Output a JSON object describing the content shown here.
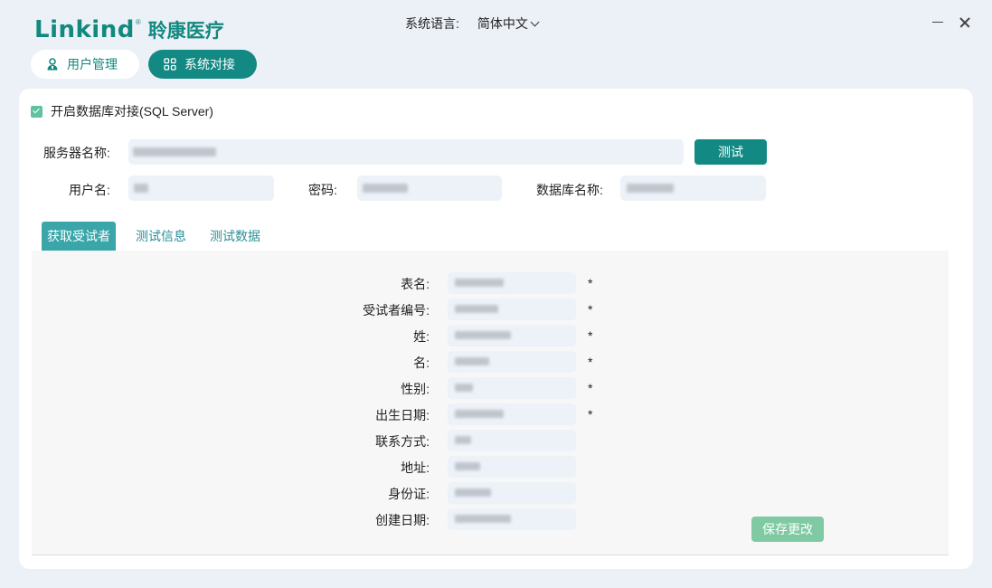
{
  "app": {
    "logo_en": "Linkind",
    "logo_reg": "®",
    "logo_cn": "聆康医疗"
  },
  "header": {
    "language_label": "系统语言:",
    "language_value": "简体中文"
  },
  "nav": {
    "user_mgmt": "用户管理",
    "sys_integration": "系统对接"
  },
  "db": {
    "enable_label": "开启数据库对接(SQL Server)",
    "enabled": true,
    "server_label": "服务器名称:",
    "test_button": "测试",
    "username_label": "用户名:",
    "password_label": "密码:",
    "dbname_label": "数据库名称:"
  },
  "tabs": [
    {
      "label": "获取受试者",
      "active": true
    },
    {
      "label": "测试信息",
      "active": false
    },
    {
      "label": "测试数据",
      "active": false
    }
  ],
  "fields": [
    {
      "label": "表名:",
      "required": "*"
    },
    {
      "label": "受试者编号:",
      "required": "*"
    },
    {
      "label": "姓:",
      "required": "*"
    },
    {
      "label": "名:",
      "required": "*"
    },
    {
      "label": "性别:",
      "required": "*"
    },
    {
      "label": "出生日期:",
      "required": "*"
    },
    {
      "label": "联系方式:",
      "required": ""
    },
    {
      "label": "地址:",
      "required": ""
    },
    {
      "label": "身份证:",
      "required": ""
    },
    {
      "label": "创建日期:",
      "required": ""
    }
  ],
  "save_button": "保存更改",
  "colors": {
    "brand": "#12897f",
    "primary_button": "#138983",
    "active_tab": "#3aa6a9",
    "save_button": "#7fcaa2",
    "checkbox": "#5fc3a0"
  }
}
